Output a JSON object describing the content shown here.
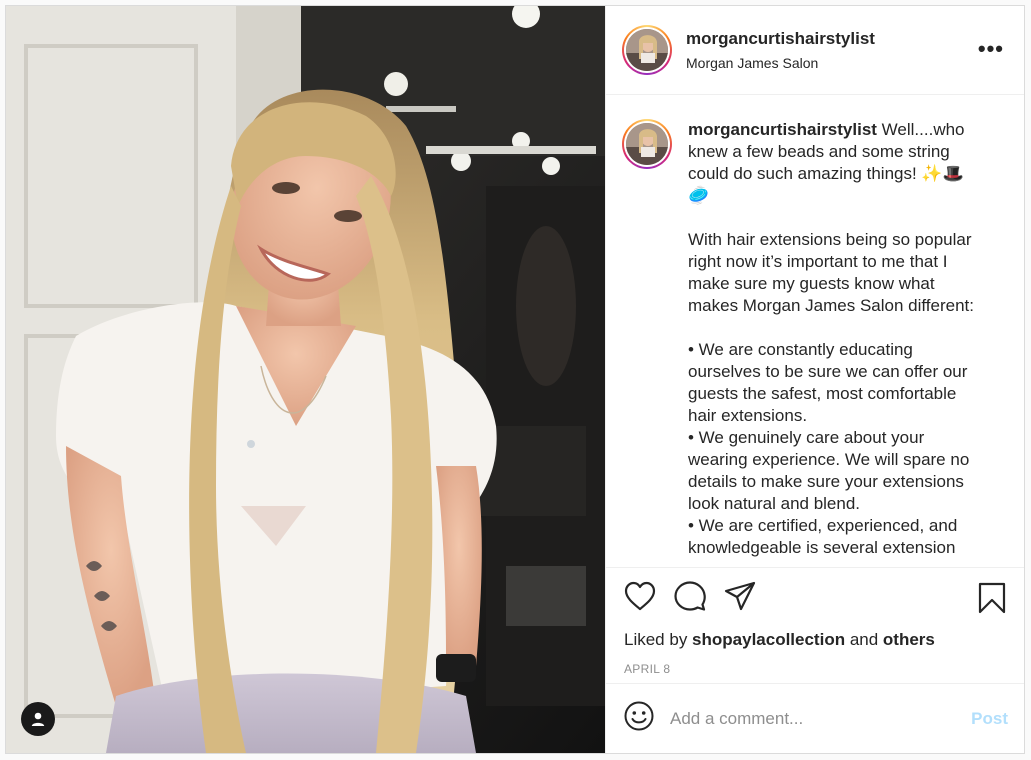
{
  "header": {
    "username": "morgancurtishairstylist",
    "location": "Morgan James Salon",
    "more": "•••"
  },
  "caption": {
    "username": "morgancurtishairstylist",
    "text": " Well....who knew a few beads and some string could do such amazing things! ✨🎩\n🥏\n\nWith hair extensions being so popular right now it’s important to me that I make sure my guests know what makes Morgan James Salon different:\n\n• We are constantly educating ourselves to be sure we can offer our guests the safest, most comfortable hair extensions.\n• We genuinely care about your wearing experience. We will spare no details to make sure your extensions look natural and blend.\n• We are certified, experienced, and knowledgeable is several extension"
  },
  "likes": {
    "prefix": "Liked by ",
    "user": "shopaylacollection",
    "middle": " and ",
    "others": "others"
  },
  "date": "APRIL 8",
  "comment": {
    "placeholder": "Add a comment...",
    "post_label": "Post"
  },
  "colors": {
    "post_button_disabled": "#b2dffc",
    "date_gray": "#8e8e8e",
    "text": "#262626"
  }
}
